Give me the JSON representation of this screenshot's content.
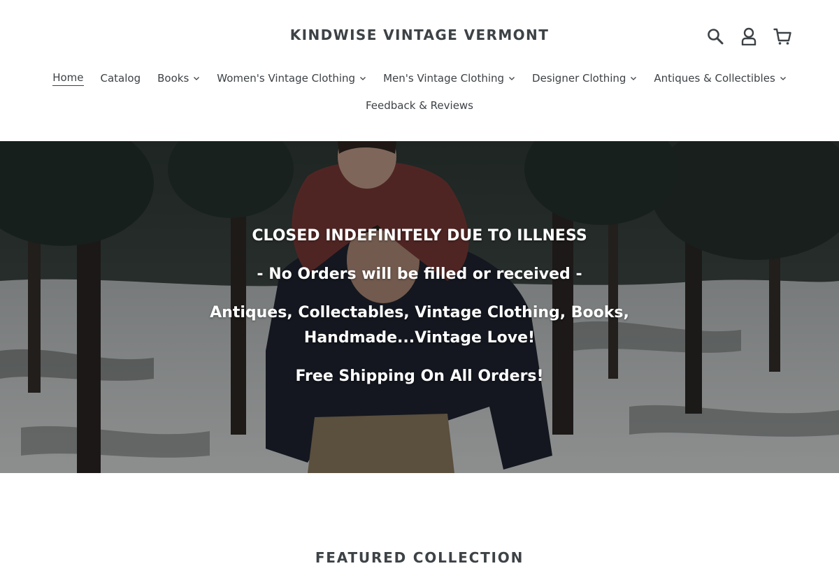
{
  "header": {
    "logo": "KINDWISE VINTAGE VERMONT",
    "icons": {
      "search": "search-icon",
      "account": "account-icon",
      "cart": "cart-icon"
    }
  },
  "nav": {
    "items": [
      {
        "label": "Home",
        "has_dropdown": false,
        "active": true
      },
      {
        "label": "Catalog",
        "has_dropdown": false
      },
      {
        "label": "Books",
        "has_dropdown": true
      },
      {
        "label": "Women's Vintage Clothing",
        "has_dropdown": true
      },
      {
        "label": "Men's Vintage Clothing",
        "has_dropdown": true
      },
      {
        "label": "Designer Clothing",
        "has_dropdown": true
      },
      {
        "label": "Antiques & Collectibles",
        "has_dropdown": true
      },
      {
        "label": "Feedback & Reviews",
        "has_dropdown": false
      }
    ]
  },
  "hero": {
    "line1": "CLOSED INDEFINITELY DUE TO ILLNESS",
    "line2": "- No Orders will be filled or received -",
    "line3": "Antiques, Collectables, Vintage Clothing, Books, Handmade...Vintage Love!",
    "line4": "Free Shipping On All Orders!"
  },
  "featured": {
    "title": "FEATURED COLLECTION"
  },
  "colors": {
    "text": "#3d4246",
    "background": "#ffffff",
    "hero_text": "#ffffff"
  }
}
